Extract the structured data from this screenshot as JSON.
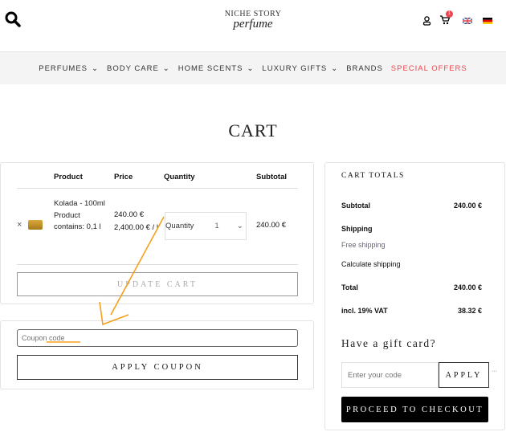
{
  "header": {
    "logo_top": "NICHE STORY",
    "logo_bottom": "perfume",
    "cart_count": "1",
    "icons": [
      "search-icon",
      "user-icon",
      "cart-icon",
      "flag-uk-icon",
      "flag-de-icon"
    ]
  },
  "nav": {
    "items": [
      {
        "label": "PERFUMES"
      },
      {
        "label": "BODY CARE"
      },
      {
        "label": "HOME SCENTS"
      },
      {
        "label": "LUXURY GIFTS"
      },
      {
        "label": "BRANDS"
      },
      {
        "label": "SPECIAL OFFERS"
      }
    ],
    "special_color": "#f0454f"
  },
  "page_title": "CART",
  "cart": {
    "headers": {
      "product": "Product",
      "price": "Price",
      "quantity": "Quantity",
      "subtotal": "Subtotal"
    },
    "row": {
      "name": "Kolada - 100ml",
      "contains": "Product contains: 0,1 l",
      "price": "240.00 €",
      "unit_price": "2,400.00 € / l",
      "qty_label": "Quantity",
      "qty": "1",
      "subtotal": "240.00 €"
    },
    "update_label": "UPDATE CART"
  },
  "coupon": {
    "placeholder": "Coupon code",
    "apply_label": "APPLY COUPON"
  },
  "totals": {
    "title": "CART TOTALS",
    "subtotal_label": "Subtotal",
    "subtotal": "240.00 €",
    "shipping_label": "Shipping",
    "shipping_value": "Free shipping",
    "calc_label": "Calculate shipping",
    "total_label": "Total",
    "total": "240.00 €",
    "vat_label": "incl. 19% VAT",
    "vat": "38.32 €"
  },
  "gift": {
    "title": "Have a gift card?",
    "placeholder": "Enter your code",
    "apply_label": "APPLY",
    "more": "···",
    "checkout_label": "PROCEED TO CHECKOUT"
  },
  "annotation_color": "#f5a01a"
}
